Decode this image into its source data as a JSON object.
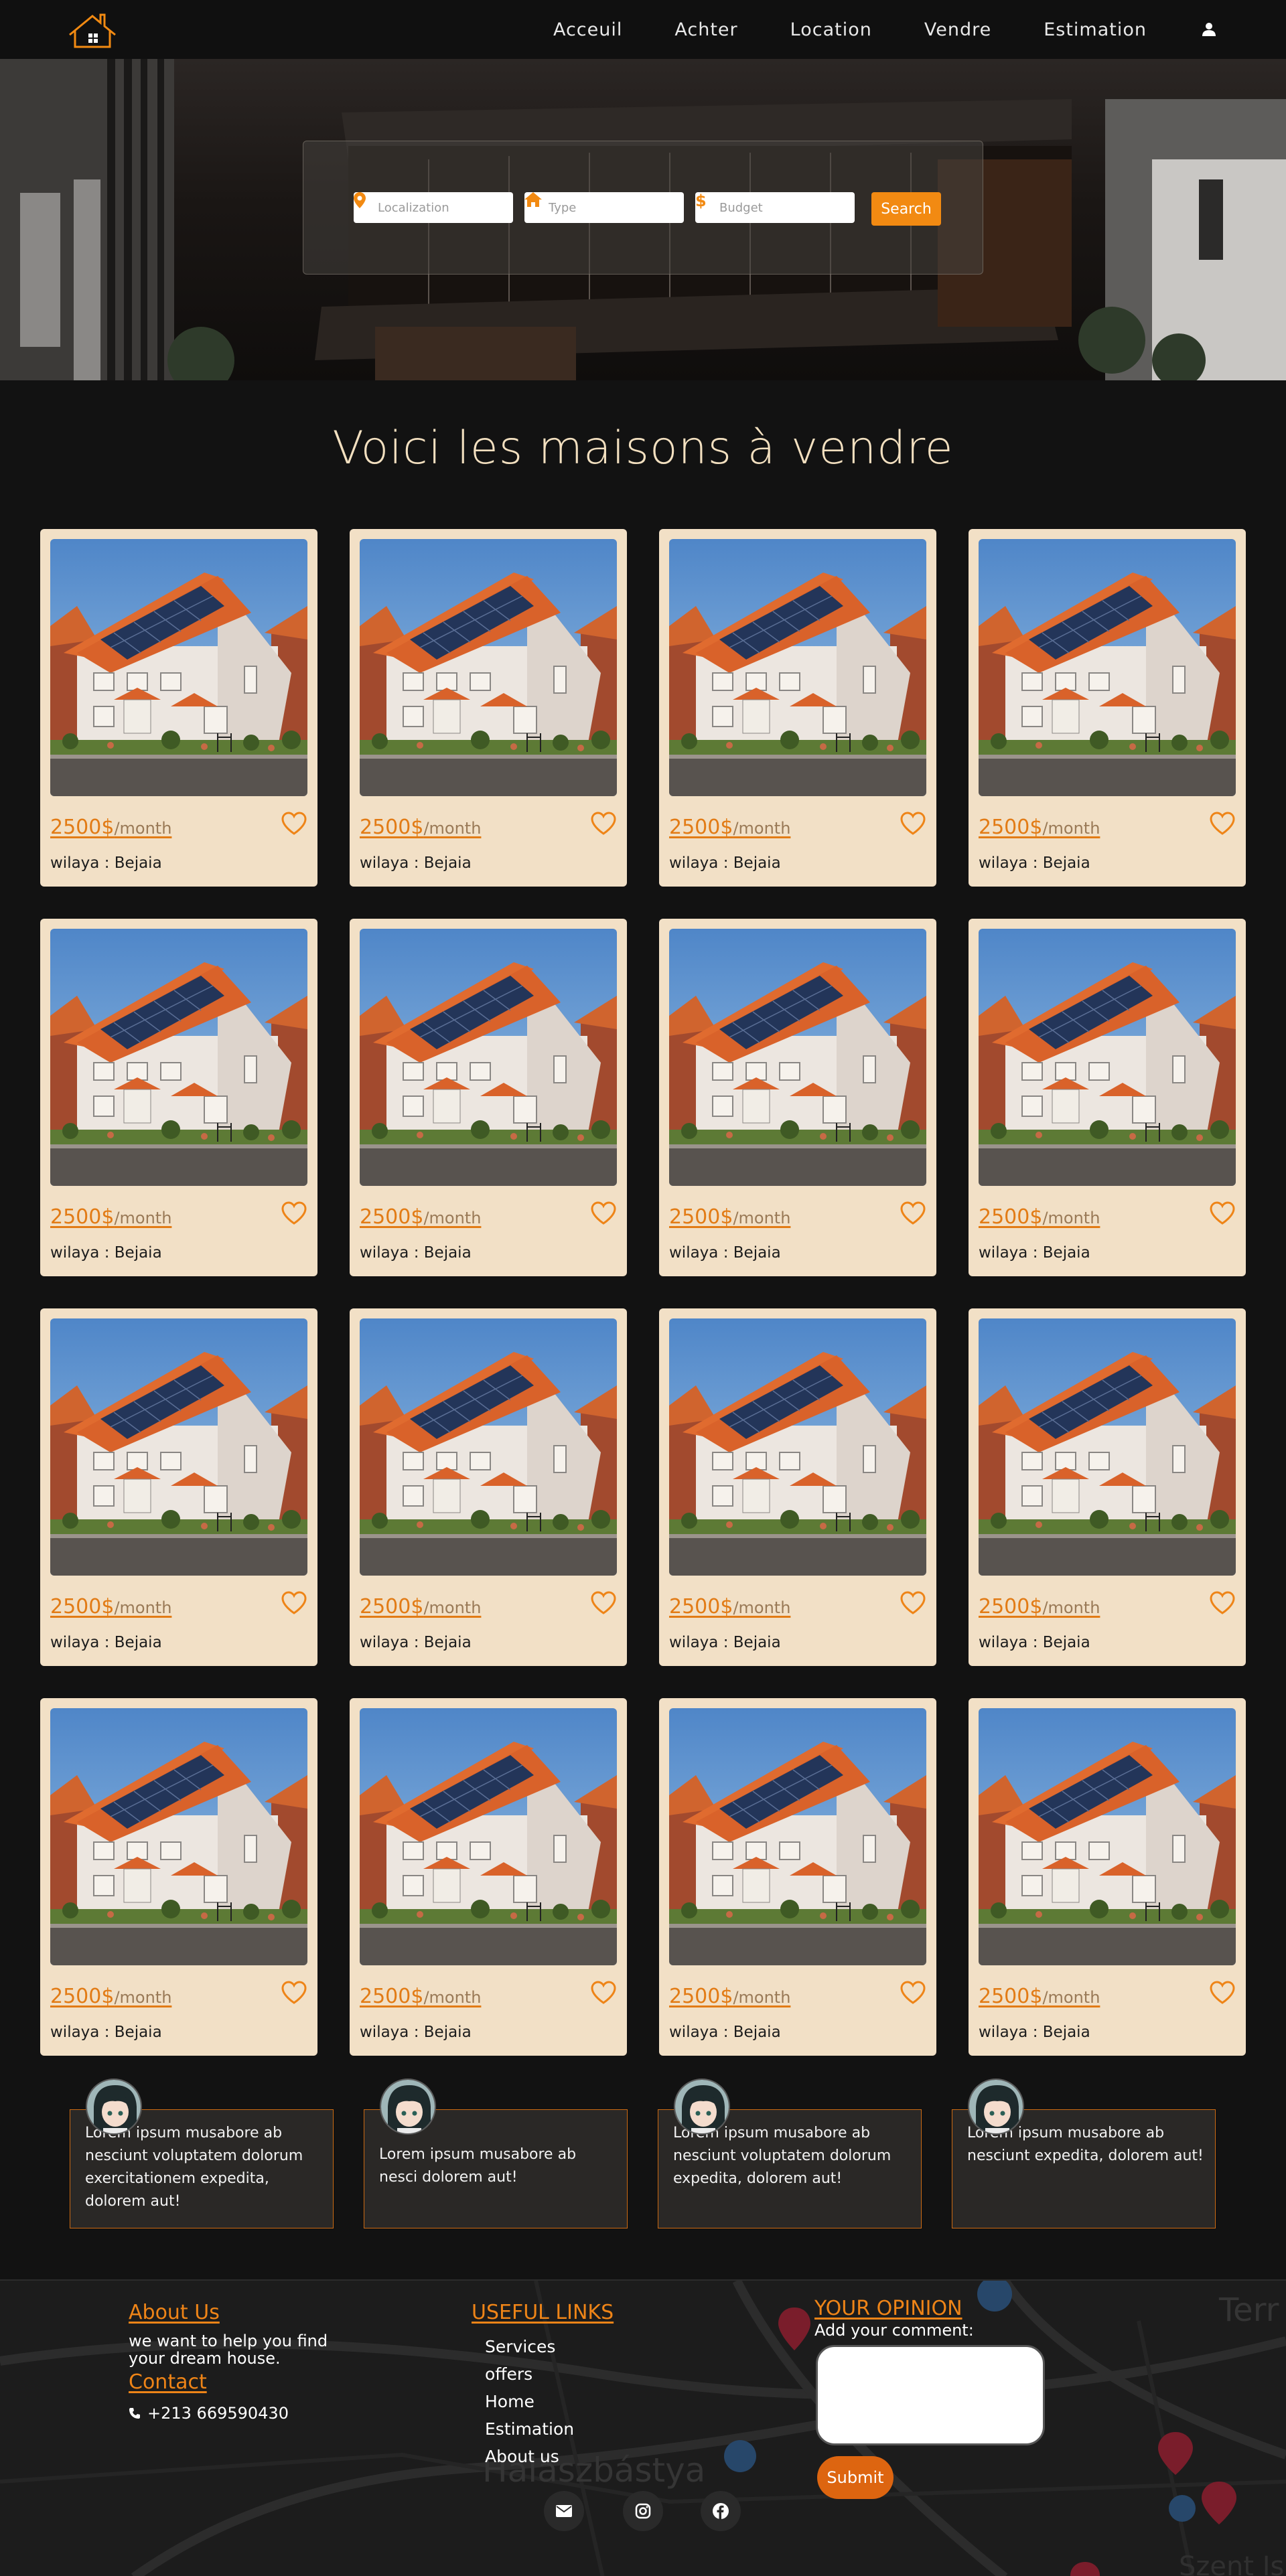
{
  "nav": {
    "logo": "house-logo",
    "links": [
      {
        "label": "Acceuil"
      },
      {
        "label": "Achter"
      },
      {
        "label": "Location"
      },
      {
        "label": "Vendre"
      },
      {
        "label": "Estimation"
      }
    ],
    "user_icon": "user-icon"
  },
  "search": {
    "localization_placeholder": "Localization",
    "type_placeholder": "Type",
    "budget_placeholder": "Budget",
    "button_label": "Search"
  },
  "section_title": "Voici les maisons à vendre",
  "listings": [
    {
      "price": "2500$",
      "period": "/month",
      "location": "wilaya : Bejaia"
    },
    {
      "price": "2500$",
      "period": "/month",
      "location": "wilaya : Bejaia"
    },
    {
      "price": "2500$",
      "period": "/month",
      "location": "wilaya : Bejaia"
    },
    {
      "price": "2500$",
      "period": "/month",
      "location": "wilaya : Bejaia"
    },
    {
      "price": "2500$",
      "period": "/month",
      "location": "wilaya : Bejaia"
    },
    {
      "price": "2500$",
      "period": "/month",
      "location": "wilaya : Bejaia"
    },
    {
      "price": "2500$",
      "period": "/month",
      "location": "wilaya : Bejaia"
    },
    {
      "price": "2500$",
      "period": "/month",
      "location": "wilaya : Bejaia"
    },
    {
      "price": "2500$",
      "period": "/month",
      "location": "wilaya : Bejaia"
    },
    {
      "price": "2500$",
      "period": "/month",
      "location": "wilaya : Bejaia"
    },
    {
      "price": "2500$",
      "period": "/month",
      "location": "wilaya : Bejaia"
    },
    {
      "price": "2500$",
      "period": "/month",
      "location": "wilaya : Bejaia"
    },
    {
      "price": "2500$",
      "period": "/month",
      "location": "wilaya : Bejaia"
    },
    {
      "price": "2500$",
      "period": "/month",
      "location": "wilaya : Bejaia"
    },
    {
      "price": "2500$",
      "period": "/month",
      "location": "wilaya : Bejaia"
    },
    {
      "price": "2500$",
      "period": "/month",
      "location": "wilaya : Bejaia"
    }
  ],
  "testimonials": [
    {
      "text": "Lorem ipsum musabore ab nesciunt voluptatem dolorum exercitationem expedita, dolorem aut!"
    },
    {
      "text": "Lorem ipsum musabore ab nesci dolorem aut!"
    },
    {
      "text": "Lorem ipsum musabore ab nesciunt voluptatem dolorum expedita, dolorem aut!"
    },
    {
      "text": "Lorem ipsum musabore ab nesciunt expedita, dolorem aut!"
    }
  ],
  "footer": {
    "about_title": "About Us",
    "about_text_1": "we want to help you find",
    "about_text_2": "your dream house.",
    "contact_title": "Contact",
    "phone": "+213 669590430",
    "links_title": "USEFUL LINKS",
    "links": [
      {
        "label": "Services"
      },
      {
        "label": "offers"
      },
      {
        "label": "Home"
      },
      {
        "label": "Estimation"
      },
      {
        "label": "About us"
      }
    ],
    "opinion_title": "YOUR OPINION",
    "comment_label": "Add your comment:",
    "submit_label": "Submit",
    "map_label": "Halászbástya",
    "map_label_2": "Szent Is",
    "map_label_3": "Terr",
    "social": [
      "envelope-icon",
      "instagram-icon",
      "facebook-icon"
    ]
  },
  "colors": {
    "accent": "#f28a12",
    "card_bg": "#f2e0c6",
    "page_bg": "#121212",
    "title": "#f3e0c0"
  }
}
